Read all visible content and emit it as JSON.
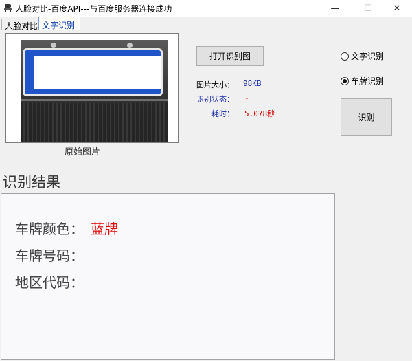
{
  "window": {
    "title": "人脸对比-百度API---与百度服务器连接成功",
    "minimize_glyph": "—",
    "maximize_glyph": "☐",
    "close_glyph": "✕"
  },
  "tabs": [
    {
      "label": "人脸对比",
      "selected": false
    },
    {
      "label": "文字识别",
      "selected": true
    }
  ],
  "image_panel": {
    "caption": "原始图片"
  },
  "buttons": {
    "open_image": "打开识别图",
    "recognize": "识别"
  },
  "info": {
    "size_label": "图片大小：",
    "size_value": "98KB",
    "status_label": "识别状态：",
    "status_value": "-",
    "time_label": "耗时：",
    "time_value": "5.078秒"
  },
  "mode": {
    "options": [
      {
        "label": "文字识别",
        "selected": false
      },
      {
        "label": "车牌识别",
        "selected": true
      }
    ]
  },
  "result": {
    "title": "识别结果",
    "rows": [
      {
        "label": "车牌颜色：",
        "value": "蓝牌"
      },
      {
        "label": "车牌号码：",
        "value": ""
      },
      {
        "label": "地区代码：",
        "value": ""
      }
    ]
  },
  "colors": {
    "plate_blue": "#1f55c9",
    "value_red": "#e00000",
    "label_blue": "#1a2aa8"
  }
}
